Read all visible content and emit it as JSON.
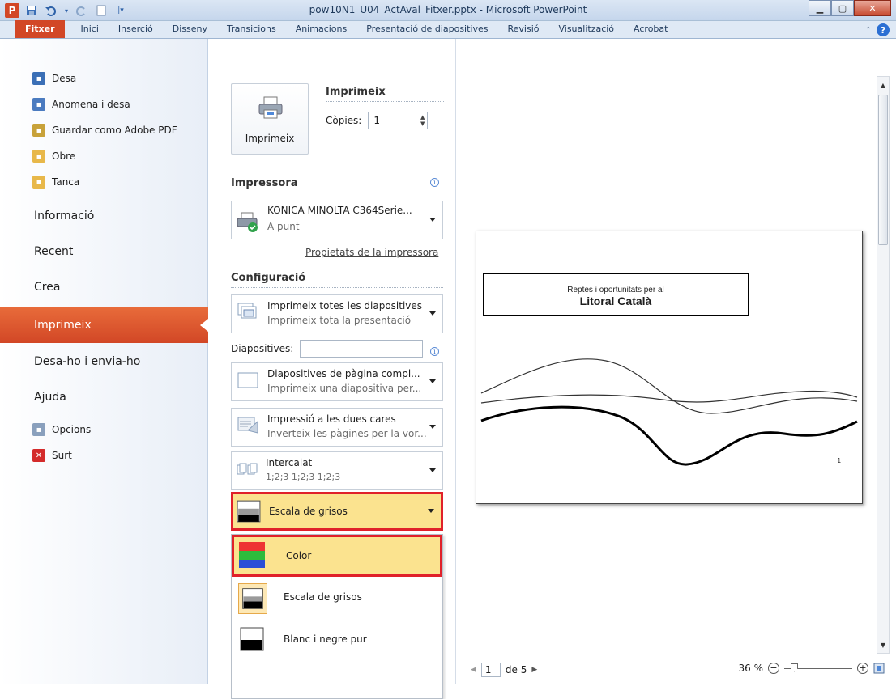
{
  "window": {
    "title": "pow10N1_U04_ActAval_Fitxer.pptx - Microsoft PowerPoint",
    "app_letter": "P"
  },
  "ribbon": {
    "tabs": [
      "Fitxer",
      "Inici",
      "Inserció",
      "Disseny",
      "Transicions",
      "Animacions",
      "Presentació de diapositives",
      "Revisió",
      "Visualització",
      "Acrobat"
    ]
  },
  "nav": {
    "small": [
      "Desa",
      "Anomena i desa",
      "Guardar como Adobe PDF",
      "Obre",
      "Tanca"
    ],
    "big": [
      "Informació",
      "Recent",
      "Crea",
      "Imprimeix",
      "Desa-ho i envia-ho",
      "Ajuda"
    ],
    "bottom": [
      "Opcions",
      "Surt"
    ]
  },
  "print": {
    "heading": "Imprimeix",
    "button_label": "Imprimeix",
    "copies_label": "Còpies:",
    "copies_value": "1"
  },
  "printer": {
    "heading": "Impressora",
    "name": "KONICA MINOLTA C364Serie...",
    "status": "A punt",
    "properties_link": "Propietats de la impressora"
  },
  "settings": {
    "heading": "Configuració",
    "range_main": "Imprimeix totes les diapositives",
    "range_sub": "Imprimeix tota la presentació",
    "slides_label": "Diapositives:",
    "layout_main": "Diapositives de pàgina compl...",
    "layout_sub": "Imprimeix una diapositiva per...",
    "duplex_main": "Impressió a les dues cares",
    "duplex_sub": "Inverteix les pàgines per la vor...",
    "collate_main": "Intercalat",
    "collate_sub": "1;2;3   1;2;3   1;2;3",
    "color_main": "Escala de grisos"
  },
  "color_menu": {
    "options": [
      "Color",
      "Escala de grisos",
      "Blanc i negre pur"
    ]
  },
  "preview": {
    "slide_subtitle": "Reptes i oportunitats per al",
    "slide_title": "Litoral Català",
    "slide_number": "1",
    "page_current": "1",
    "page_total": "de 5",
    "zoom": "36 %"
  }
}
